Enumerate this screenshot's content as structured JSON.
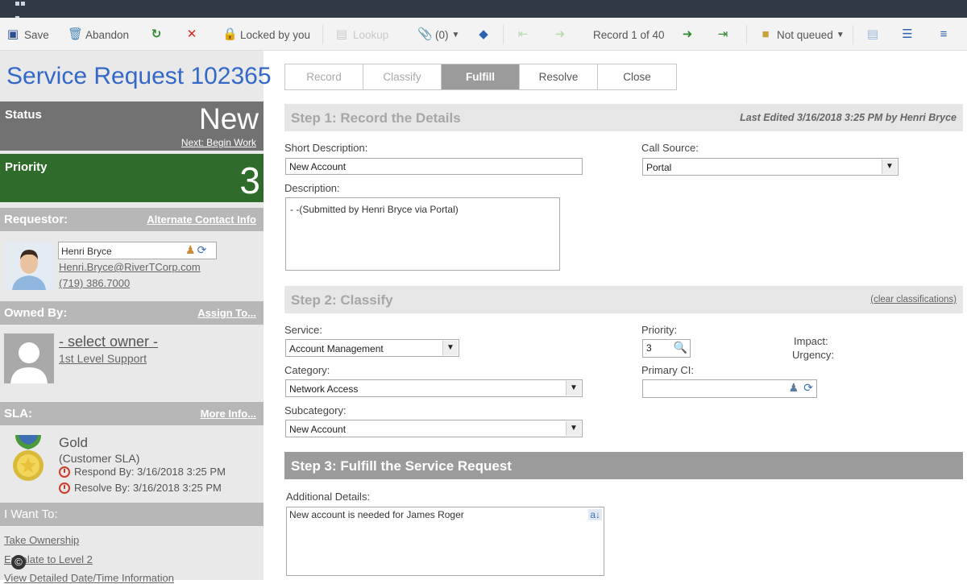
{
  "toolbar": {
    "save": "Save",
    "abandon": "Abandon",
    "locked": "Locked by you",
    "lookup": "Lookup",
    "attachments": "(0)",
    "record_position": "Record 1 of 40",
    "queue": "Not queued"
  },
  "left": {
    "title": "Service Request 102365",
    "status_label": "Status",
    "status_value": "New",
    "next_action": "Next: Begin Work",
    "priority_label": "Priority",
    "priority_value": "3",
    "requestor_header": "Requestor:",
    "alt_contact": "Alternate Contact Info",
    "requestor_name": "Henri Bryce",
    "requestor_email": "Henri.Bryce@RiverTCorp.com",
    "requestor_phone": "(719) 386.7000",
    "owned_header": "Owned By:",
    "assign_to": "Assign To...",
    "owner_name": "- select owner -",
    "owner_team": "1st Level Support",
    "sla_header": "SLA:",
    "sla_more": "More Info...",
    "sla_name": "Gold",
    "sla_type": "(Customer SLA)",
    "respond_by": "Respond By: 3/16/2018 3:25 PM",
    "resolve_by": "Resolve By: 3/16/2018 3:25 PM",
    "want_header": "I Want To:",
    "actions": [
      "Take Ownership",
      "Escalate to Level 2",
      "View Detailed Date/Time Information"
    ]
  },
  "tabs": [
    "Record",
    "Classify",
    "Fulfill",
    "Resolve",
    "Close"
  ],
  "step1": {
    "title": "Step 1: Record the Details",
    "last_edited": "Last Edited 3/16/2018 3:25 PM by Henri Bryce",
    "short_desc_label": "Short Description:",
    "short_desc": "New Account",
    "call_source_label": "Call Source:",
    "call_source": "Portal",
    "desc_label": "Description:",
    "desc": "- -(Submitted by Henri Bryce via Portal)"
  },
  "step2": {
    "title": "Step 2: Classify",
    "clear": "(clear classifications)",
    "service_label": "Service:",
    "service": "Account Management",
    "priority_label": "Priority:",
    "priority": "3",
    "impact_label": "Impact:",
    "urgency_label": "Urgency:",
    "category_label": "Category:",
    "category": "Network Access",
    "primary_ci_label": "Primary CI:",
    "subcategory_label": "Subcategory:",
    "subcategory": "New Account"
  },
  "step3": {
    "title": "Step 3: Fulfill the Service Request",
    "details_label": "Additional Details:",
    "details": "New account is needed for James Roger"
  },
  "colors": {
    "title_blue": "#3468c8",
    "priority_green": "#2f6b2a",
    "status_gray": "#727272"
  }
}
